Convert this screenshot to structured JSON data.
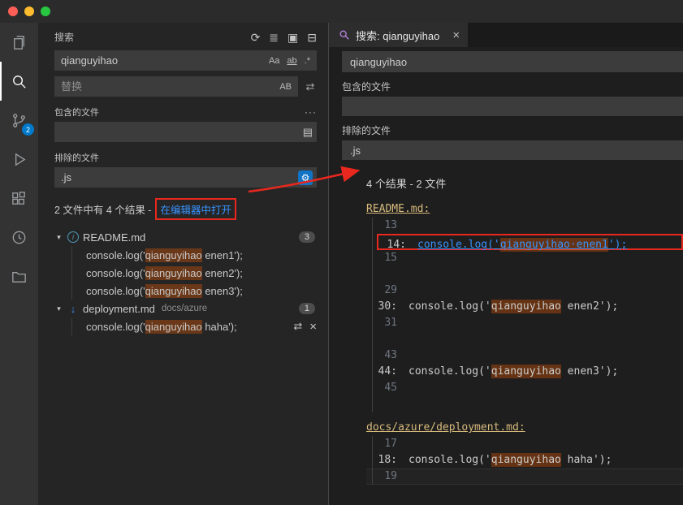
{
  "titlebar": {
    "traffic_lights": [
      "#ff5f57",
      "#febc2e",
      "#28c840"
    ]
  },
  "activity_bar": {
    "scm_badge": "2"
  },
  "colors": {
    "link": "#3794ff",
    "match_highlight": "rgba(234,92,0,0.35)",
    "file_heading": "#d7ba7d",
    "badge_bg": "#4d4d4d",
    "activity_badge": "#007acc",
    "annotation": "#e8281e",
    "tab_icon": "#b180d7",
    "file_icon_blue": "#519aba",
    "deploy_icon": "#3b8eea"
  },
  "icons": {
    "refresh": "⟳",
    "clear_results": "≣",
    "open_new_search_editor": "▣",
    "collapse_all": "⊟",
    "match_case": "Aa",
    "whole_word": "ab",
    "regex": ".*",
    "preserve_case": "AB",
    "replace_all": "⇄",
    "more": "···",
    "open_in_editor_book": "▤",
    "gear": "⚙",
    "chevron_down": "▾",
    "info": "i",
    "deploy_arrow": "↓",
    "close": "×",
    "replace_action": "⇄",
    "dismiss": "×"
  },
  "sidebar": {
    "title": "搜索",
    "search": {
      "value": "qianguyihao"
    },
    "replace": {
      "placeholder": "替换"
    },
    "include": {
      "label": "包含的文件",
      "value": ""
    },
    "exclude": {
      "label": "排除的文件",
      "value": ".js"
    },
    "summary": {
      "text": "2 文件中有 4 个结果 -",
      "link": "在编辑器中打开"
    },
    "files": [
      {
        "name": "README.md",
        "icon": "info",
        "badge": "3",
        "matches": [
          {
            "pre": "console.log('",
            "match": "qianguyihao",
            "post": " enen1');"
          },
          {
            "pre": "console.log('",
            "match": "qianguyihao",
            "post": " enen2');"
          },
          {
            "pre": "console.log('",
            "match": "qianguyihao",
            "post": " enen3');"
          }
        ]
      },
      {
        "name": "deployment.md",
        "icon": "deploy",
        "desc": "docs/azure",
        "badge": "1",
        "matches": [
          {
            "pre": "console.log('",
            "match": "qianguyihao",
            "post": " haha');",
            "actions": true
          }
        ]
      }
    ]
  },
  "editor": {
    "tab": {
      "label": "搜索: qianguyihao"
    },
    "query": "qianguyihao",
    "include": {
      "label": "包含的文件",
      "value": ""
    },
    "exclude": {
      "label": "排除的文件",
      "value": ".js"
    },
    "summary": "4 个结果 - 2 文件",
    "blocks": [
      {
        "file": "README.md:",
        "lines": [
          {
            "num": "13"
          },
          {
            "num": "14:",
            "pre": "console.log('",
            "match": "qianguyihao·enen1",
            "post": "');",
            "link": true
          },
          {
            "num": "15"
          },
          {
            "num": ""
          },
          {
            "num": "29"
          },
          {
            "num": "30:",
            "pre": "console.log('",
            "match": "qianguyihao",
            "post": " enen2');"
          },
          {
            "num": "31"
          },
          {
            "num": ""
          },
          {
            "num": "43"
          },
          {
            "num": "44:",
            "pre": "console.log('",
            "match": "qianguyihao",
            "post": " enen3');"
          },
          {
            "num": "45"
          },
          {
            "num": ""
          }
        ]
      },
      {
        "file": "docs/azure/deployment.md:",
        "lines": [
          {
            "num": "17"
          },
          {
            "num": "18:",
            "pre": "console.log('",
            "match": "qianguyihao",
            "post": " haha');"
          },
          {
            "num": "19"
          }
        ]
      }
    ]
  }
}
